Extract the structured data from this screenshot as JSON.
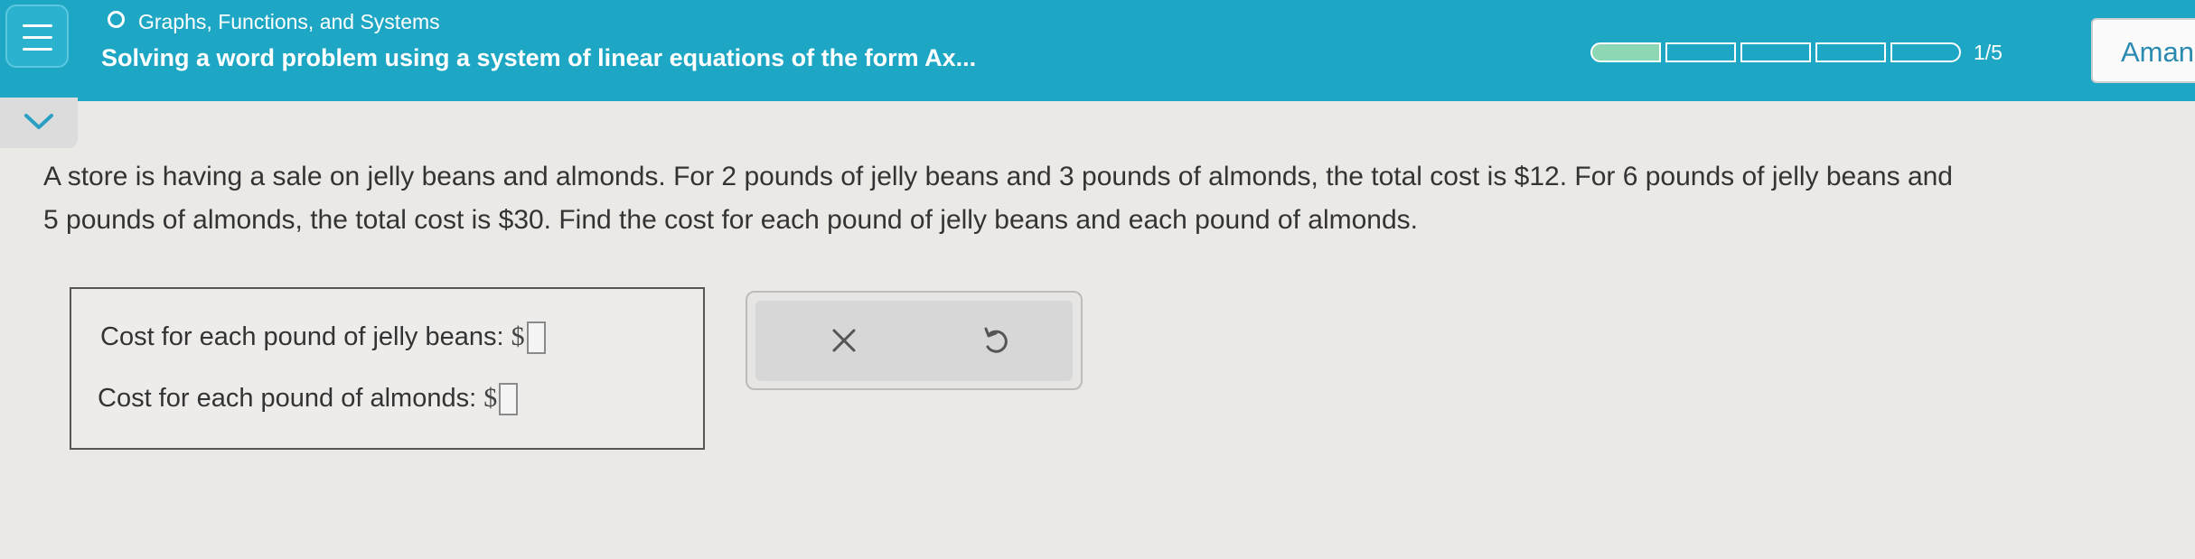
{
  "header": {
    "topic": "Graphs, Functions, and Systems",
    "title": "Solving a word problem using a system of linear equations of the form Ax...",
    "progress": {
      "current": 1,
      "total": 5,
      "label": "1/5"
    },
    "user_name": "Aman",
    "icons": {
      "menu": "hamburger-menu-icon",
      "topic": "circle-icon"
    }
  },
  "collapse": {
    "icon": "chevron-down-icon"
  },
  "question": {
    "line1": "A store is having a sale on jelly beans and almonds. For 2 pounds of jelly beans and 3 pounds of almonds, the total cost is $12. For 6 pounds of jelly beans and",
    "line2": "5 pounds of almonds, the total cost is $30. Find the cost for each pound of jelly beans and each pound of almonds."
  },
  "answers": [
    {
      "label": "Cost for each pound of jelly beans:",
      "prefix": "$",
      "value": ""
    },
    {
      "label": "Cost for each pound of almonds:",
      "prefix": "$",
      "value": ""
    }
  ],
  "actions": {
    "clear_icon": "x-close-icon",
    "reset_icon": "undo-icon"
  },
  "colors": {
    "header": "#1ea7c5",
    "progress_fill": "#8ed7b4",
    "background": "#ebe9e6"
  }
}
